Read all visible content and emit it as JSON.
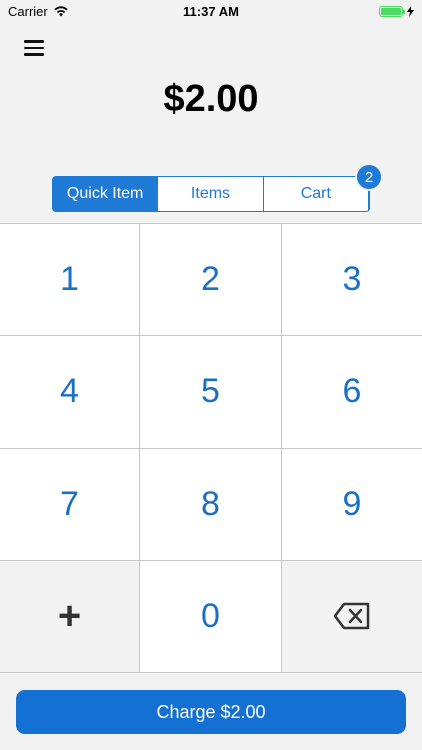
{
  "status_bar": {
    "carrier": "Carrier",
    "time": "11:37 AM",
    "battery_level": 1.0
  },
  "header": {
    "amount": "$2.00"
  },
  "tabs": {
    "items": [
      {
        "label": "Quick Item",
        "active": true
      },
      {
        "label": "Items",
        "active": false
      },
      {
        "label": "Cart",
        "active": false
      }
    ],
    "cart_count": "2"
  },
  "keypad": {
    "keys": [
      "1",
      "2",
      "3",
      "4",
      "5",
      "6",
      "7",
      "8",
      "9",
      "+",
      "0",
      "backspace"
    ]
  },
  "charge": {
    "label": "Charge $2.00"
  },
  "colors": {
    "accent": "#1f7ad6",
    "button": "#1470d2",
    "battery": "#4cd964"
  }
}
